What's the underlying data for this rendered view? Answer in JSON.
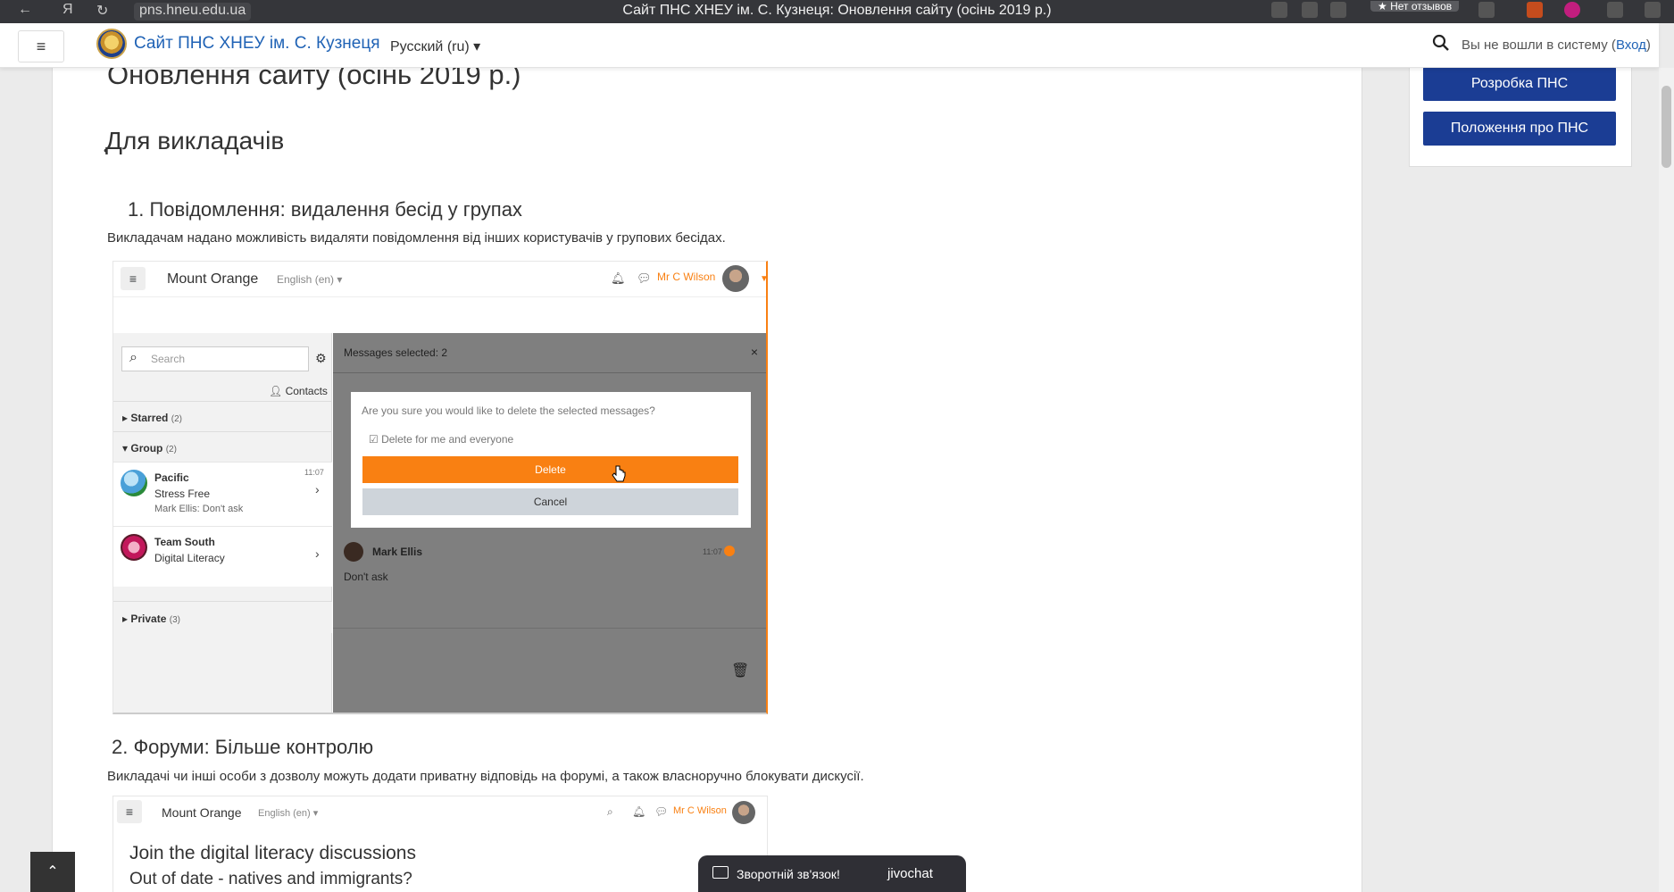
{
  "browser": {
    "url": "pns.hneu.edu.ua",
    "title": "Сайт ПНС ХНЕУ ім. С. Кузнеця: Оновлення сайту (осінь 2019 р.)",
    "review_label": "★ Нет отзывов"
  },
  "navbar": {
    "site_name": "Сайт ПНС ХНЕУ ім. С. Кузнеця",
    "language": "Русский (ru) ▾",
    "login_text": "Вы не вошли в систему (",
    "login_link": "Вход",
    "login_close": ")"
  },
  "content": {
    "page_title": "Оновлення сайту (осінь 2019 р.)",
    "section_heading": "Для викладачів",
    "item1_heading": "1. Повідомлення: видалення бесід у групах",
    "item1_text": "Викладачам надано можливість видаляти повідомлення від інших користувачів у групових бесідах.",
    "item2_heading": "2. Форуми: Більше контролю",
    "item2_text": "Викладачі чи інші особи з дозволу можуть додати приватну відповідь на форумі, а також власноручно блокувати дискусії."
  },
  "screenshot1": {
    "brand": "Mount Orange",
    "language": "English (en) ▾",
    "user": "Mr C Wilson",
    "search_placeholder": "Search",
    "contacts": "Contacts",
    "starred": "Starred",
    "starred_count": "(2)",
    "group": "Group",
    "group_count": "(2)",
    "private": "Private",
    "private_count": "(3)",
    "conversations": [
      {
        "name": "Pacific",
        "subtitle": "Stress Free",
        "preview": "Mark Ellis: Don't ask",
        "time": "11:07"
      },
      {
        "name": "Team South",
        "subtitle": "Digital Literacy"
      }
    ],
    "selected_header": "Messages selected: 2",
    "dialog_question": "Are you sure you would like to delete the selected messages?",
    "dialog_checkbox": "Delete for me and everyone",
    "delete_label": "Delete",
    "cancel_label": "Cancel",
    "message_author": "Mark Ellis",
    "message_time": "11:07",
    "message_body": "Don't ask"
  },
  "screenshot2": {
    "brand": "Mount Orange",
    "language": "English (en) ▾",
    "user": "Mr C Wilson",
    "heading": "Join the digital literacy discussions",
    "subheading": "Out of date - natives and immigrants?"
  },
  "sidebar": {
    "buttons": [
      "Розробка ПНС",
      "Положення про ПНС"
    ]
  },
  "chat": {
    "label": "Зворотній зв'язок!",
    "brand": "jivochat"
  },
  "colors": {
    "moodle_orange": "#f98012",
    "brand_blue": "#1b3d94",
    "link_blue": "#1f62b5"
  }
}
